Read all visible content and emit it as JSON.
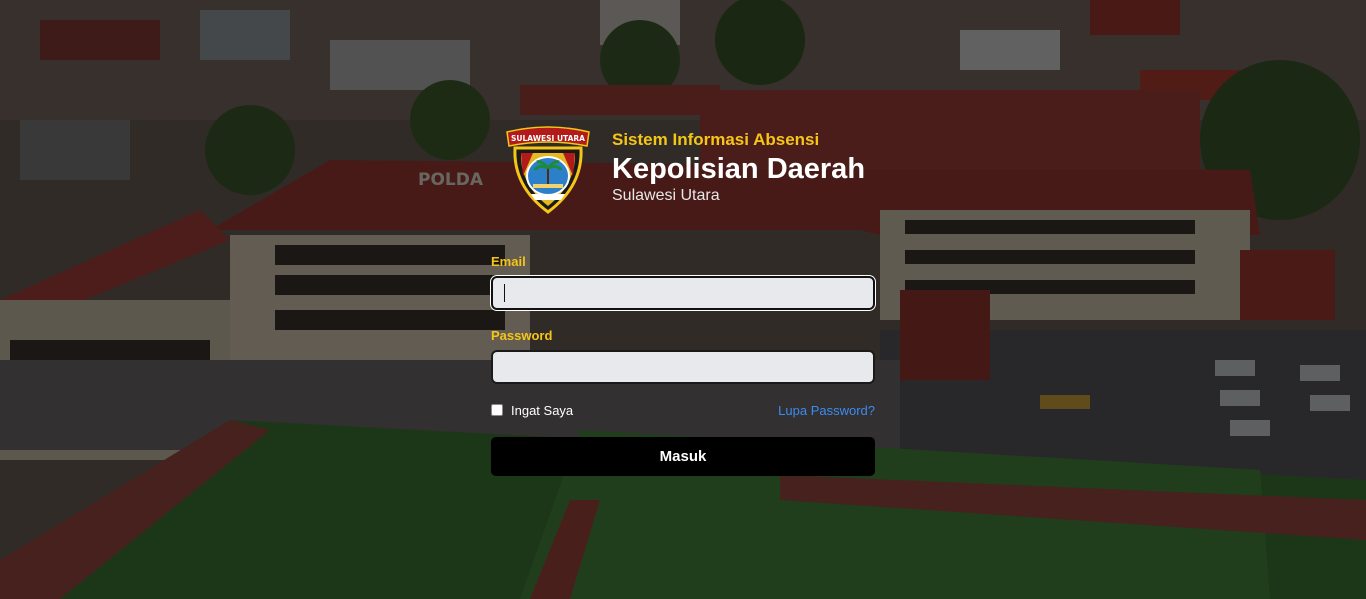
{
  "brand": {
    "app_name": "Sistem Informasi Absensi",
    "title": "Kepolisian Daerah",
    "region": "Sulawesi Utara",
    "logo_banner_text": "SULAWESI UTARA",
    "logo_icon": "police-shield-logo-icon"
  },
  "background": {
    "building_sign": "POLDA",
    "description_icon": "aerial-building-photo"
  },
  "form": {
    "email_label": "Email",
    "email_value": "",
    "password_label": "Password",
    "password_value": "",
    "remember_label": "Ingat Saya",
    "remember_checked": false,
    "forgot_link": "Lupa Password?",
    "submit_label": "Masuk"
  },
  "colors": {
    "accent_yellow": "#f5c518",
    "link_blue": "#3b8cf0",
    "button_bg": "#000000",
    "input_bg": "#e8e9ec"
  }
}
